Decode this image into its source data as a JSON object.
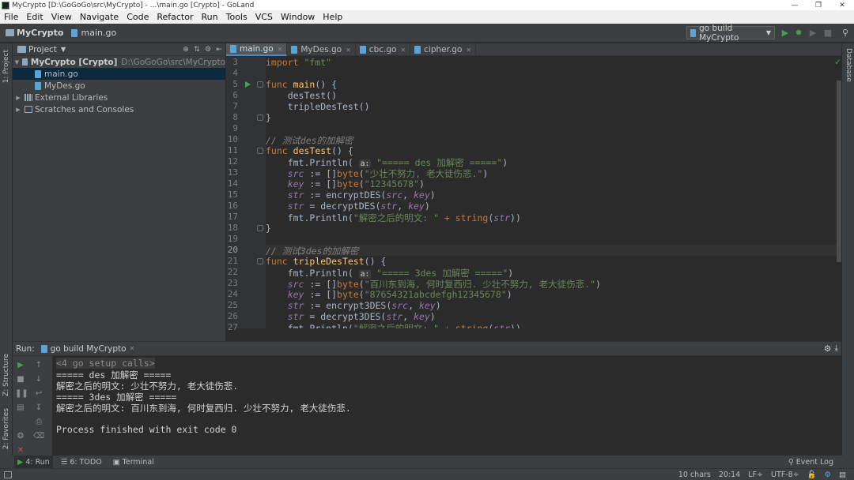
{
  "window": {
    "title": "MyCrypto [D:\\GoGoGo\\src\\MyCrypto] - ...\\main.go [Crypto] - GoLand"
  },
  "menu": [
    "File",
    "Edit",
    "View",
    "Navigate",
    "Code",
    "Refactor",
    "Run",
    "Tools",
    "VCS",
    "Window",
    "Help"
  ],
  "nav": {
    "project": "MyCrypto",
    "file": "main.go",
    "run_config": "go build MyCrypto"
  },
  "left_stripe": {
    "project": "1: Project",
    "structure": "Z: Structure",
    "favorites": "2: Favorites"
  },
  "right_stripe": {
    "database": "Database"
  },
  "project_panel": {
    "title": "Project",
    "tree": [
      {
        "label": "MyCrypto [Crypto]",
        "path": "D:\\GoGoGo\\src\\MyCrypto"
      },
      {
        "label": "main.go"
      },
      {
        "label": "MyDes.go"
      },
      {
        "label": "External Libraries"
      },
      {
        "label": "Scratches and Consoles"
      }
    ]
  },
  "editor_tabs": [
    "main.go",
    "MyDes.go",
    "cbc.go",
    "cipher.go"
  ],
  "editor": {
    "line_numbers": [
      "3",
      "4",
      "5",
      "6",
      "7",
      "8",
      "9",
      "10",
      "11",
      "12",
      "13",
      "14",
      "15",
      "16",
      "17",
      "18",
      "19",
      "20",
      "21",
      "22",
      "23",
      "24",
      "25",
      "26",
      "27"
    ],
    "tokens": {
      "import": "import",
      "fmt_q": "\"fmt\"",
      "func": "func",
      "main": "main",
      "main_tail": "() {",
      "desTest_call": "desTest()",
      "tripleDesTest_call": "tripleDesTest()",
      "close_brace": "}",
      "comment_des": "// 测试des的加解密",
      "desTest": "desTest",
      "tripleDesTest": "tripleDesTest",
      "sig_tail": "() {",
      "println_open": "fmt.Println(",
      "param_a": "a:",
      "s_des": "\"===== des 加解密 =====\"",
      "close_paren": ")",
      "src": "src",
      "key": "key",
      "str": "str",
      "decl": " := ",
      "assign": " = ",
      "byte_open": "[]",
      "byte": "byte",
      "open_paren": "(",
      "s_src1": "\"少壮不努力, 老大徒伤悲.\"",
      "s_key1": "\"12345678\"",
      "encryptDES": "encryptDES(",
      "decryptDES": "decryptDES(",
      "comma": ", ",
      "println_res": "fmt.Println(",
      "s_res": "\"解密之后的明文: \"",
      "plus": " + ",
      "string_fn": "string",
      "close2": "))",
      "comment_3des": "// 测试3des的加解密",
      "s_3des": "\"===== 3des 加解密 =====\"",
      "s_src2": "\"百川东到海, 何时复西归. 少壮不努力, 老大徒伤悲.\"",
      "s_key2": "\"87654321abcdefgh12345678\"",
      "encrypt3DES": "encrypt3DES(",
      "decrypt3DES": "decrypt3DES("
    }
  },
  "run_panel": {
    "label": "Run:",
    "tab": "go build MyCrypto",
    "output": [
      "<4 go setup calls>",
      "===== des 加解密 =====",
      "解密之后的明文: 少壮不努力, 老大徒伤悲.",
      "===== 3des 加解密 =====",
      "解密之后的明文: 百川东到海, 何时复西归. 少壮不努力, 老大徒伤悲.",
      "",
      "Process finished with exit code 0"
    ]
  },
  "tool_tabs": {
    "run": "4: Run",
    "todo": "6: TODO",
    "terminal": "Terminal",
    "event_log": "Event Log"
  },
  "status": {
    "chars": "10 chars",
    "position": "20:14",
    "line_sep": "LF÷",
    "encoding": "UTF-8÷"
  },
  "colors": {
    "keyword": "#cc7832",
    "function": "#ffc66d",
    "string": "#6a8759",
    "comment": "#808080",
    "variable": "#9876aa",
    "run_green": "#499c54"
  }
}
